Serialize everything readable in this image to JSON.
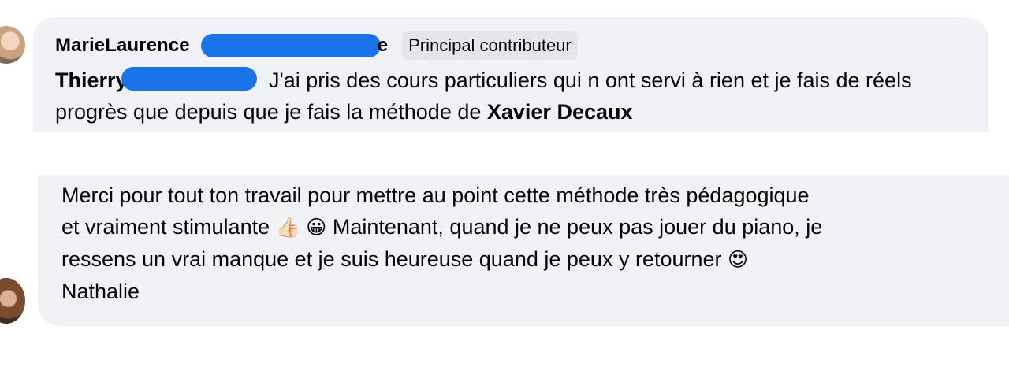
{
  "comment1": {
    "author_visible": "MarieLaurence",
    "author_trailing": "e",
    "badge": "Principal contributeur",
    "mention_visible": "Thierry",
    "text_part1": " J'ai pris des cours particuliers qui n ont servi à rien et je fais de réels progrès que depuis que je fais la méthode de ",
    "mention2": "Xavier Decaux"
  },
  "comment2": {
    "line1": "Merci pour tout ton travail pour mettre au point cette méthode très pédagogique",
    "line2_a": "et vraiment stimulante ",
    "emoji_thumbs": "👍🏻",
    "emoji_smile": "😀",
    "line2_b": " Maintenant, quand je ne peux pas jouer du piano, je",
    "line3": "ressens un vrai manque et je suis heureuse quand je peux y retourner ",
    "emoji_heart_eyes": "😍",
    "signature": "Nathalie"
  },
  "colors": {
    "bubble": "#f0f2f5",
    "badge": "#e4e6eb",
    "redaction": "#1a73e8",
    "text": "#050505"
  }
}
